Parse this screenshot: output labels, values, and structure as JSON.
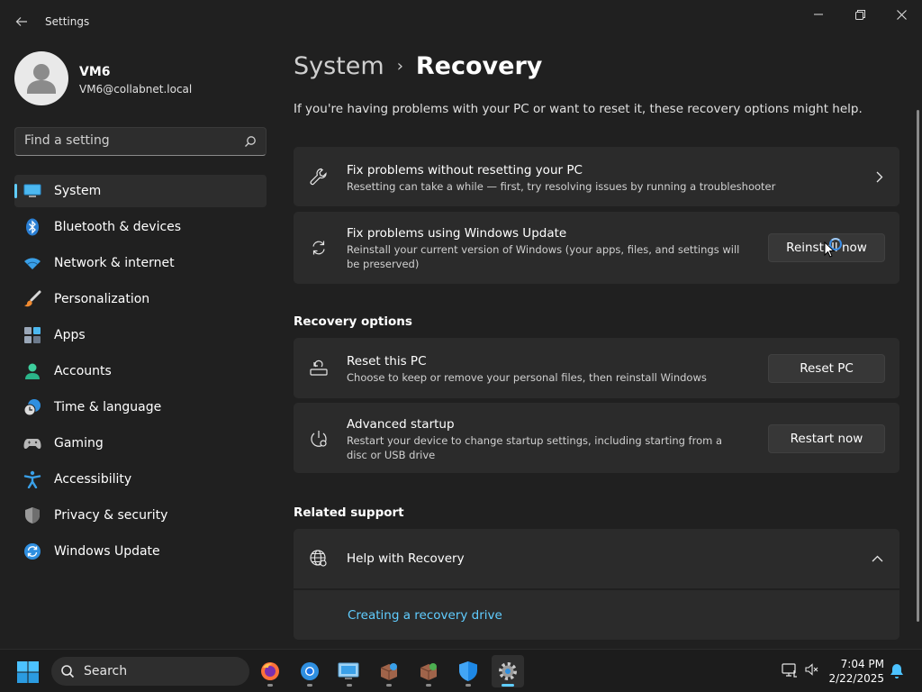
{
  "window": {
    "app_title": "Settings",
    "controls": [
      "minimize-icon",
      "restore-icon",
      "close-icon"
    ]
  },
  "profile": {
    "name": "VM6",
    "email": "VM6@collabnet.local"
  },
  "search": {
    "placeholder": "Find a setting"
  },
  "sidebar": {
    "items": [
      {
        "label": "System",
        "icon": "system-icon",
        "active": true
      },
      {
        "label": "Bluetooth & devices",
        "icon": "bluetooth-icon"
      },
      {
        "label": "Network & internet",
        "icon": "wifi-icon"
      },
      {
        "label": "Personalization",
        "icon": "brush-icon"
      },
      {
        "label": "Apps",
        "icon": "apps-icon"
      },
      {
        "label": "Accounts",
        "icon": "accounts-icon"
      },
      {
        "label": "Time & language",
        "icon": "clock-globe-icon"
      },
      {
        "label": "Gaming",
        "icon": "gamepad-icon"
      },
      {
        "label": "Accessibility",
        "icon": "accessibility-icon"
      },
      {
        "label": "Privacy & security",
        "icon": "shield-icon"
      },
      {
        "label": "Windows Update",
        "icon": "update-icon"
      }
    ]
  },
  "main": {
    "breadcrumb": {
      "parent": "System",
      "separator": "›",
      "current": "Recovery"
    },
    "intro": "If you're having problems with your PC or want to reset it, these recovery options might help.",
    "cards": {
      "fix_no_reset": {
        "title": "Fix problems without resetting your PC",
        "description": "Resetting can take a while — first, try resolving issues by running a troubleshooter"
      },
      "fix_update": {
        "title": "Fix problems using Windows Update",
        "description": "Reinstall your current version of Windows (your apps, files, and settings will be preserved)",
        "button": "Reinstall now"
      }
    },
    "recovery_options": {
      "heading": "Recovery options",
      "reset": {
        "title": "Reset this PC",
        "description": "Choose to keep or remove your personal files, then reinstall Windows",
        "button": "Reset PC"
      },
      "advanced": {
        "title": "Advanced startup",
        "description": "Restart your device to change startup settings, including starting from a disc or USB drive",
        "button": "Restart now"
      }
    },
    "related_support": {
      "heading": "Related support",
      "help_title": "Help with Recovery",
      "link": "Creating a recovery drive"
    }
  },
  "taskbar": {
    "search_label": "Search",
    "apps": [
      "firefox-icon",
      "chrome-icon",
      "remote-desktop-icon",
      "package-icon",
      "package-globe-icon",
      "defender-icon",
      "settings-icon"
    ],
    "time": "7:04 PM",
    "date": "2/22/2025"
  },
  "colors": {
    "background": "#202020",
    "card": "#2b2b2b",
    "accent": "#60cdff"
  }
}
